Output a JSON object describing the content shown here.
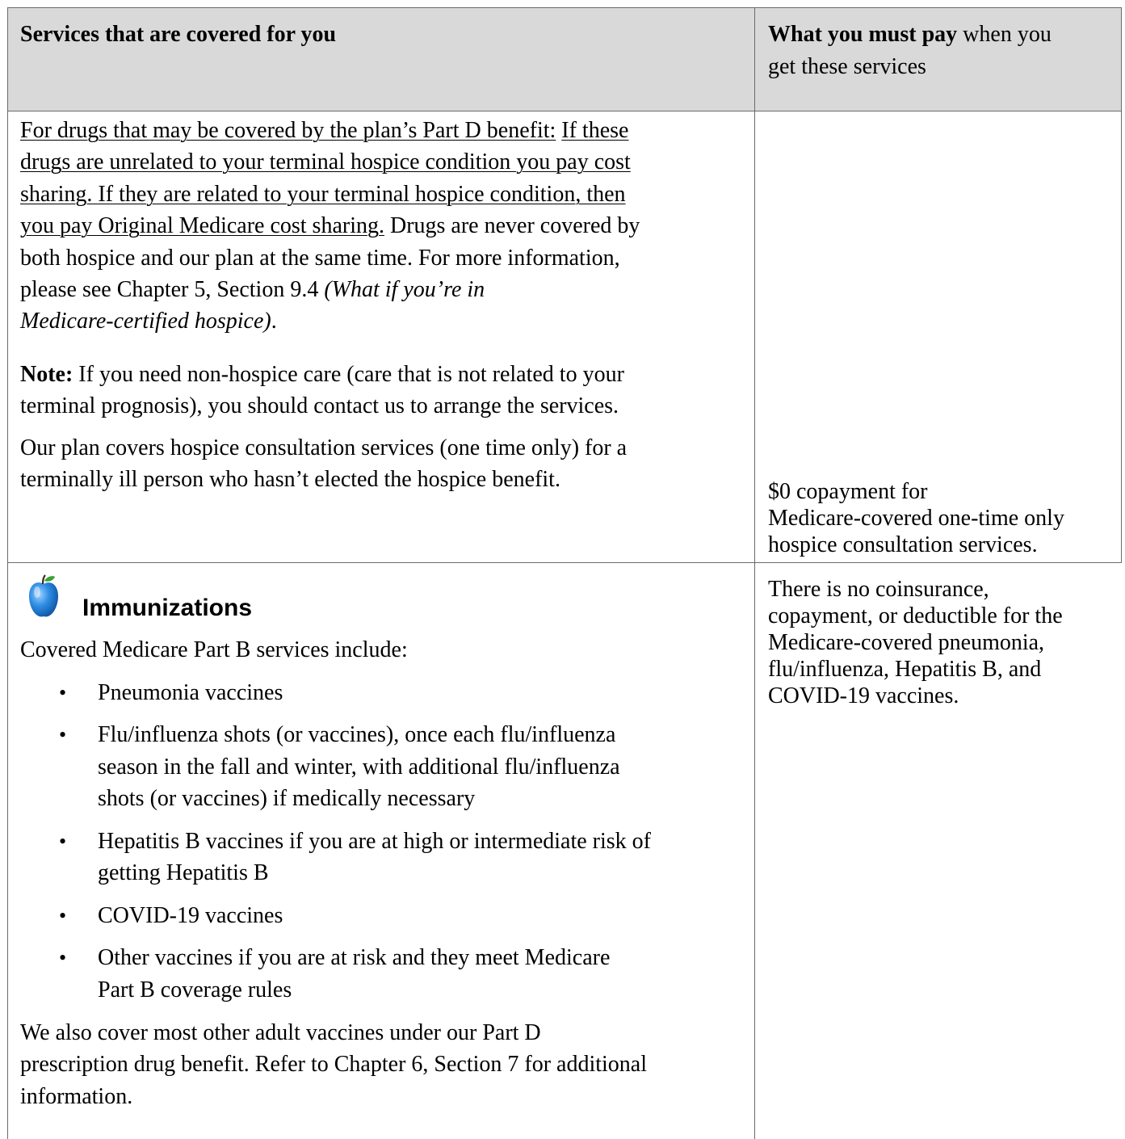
{
  "header": {
    "col1": "Services that are covered for you",
    "col2_bold": "What you must pay",
    "col2_rest": " when you",
    "col2_line2": "get these services"
  },
  "hospice": {
    "p1_line1_a": "For drugs that may be covered by the plan’s Part D benefit:",
    "p1_line1_b": "If these",
    "p1_line2": "drugs are unrelated to your terminal hospice condition you pay cost",
    "p1_line3": "sharing. If they are related to your terminal hospice condition, then",
    "p1_line4_u": "you pay Original Medicare cost sharing.",
    "p1_line4_rest": " Drugs are never covered by",
    "p1_line5": "both hospice and our plan at the same time. For more information,",
    "p1_line6_a": "please see Chapter 5, Section 9.4 ",
    "p1_line6_i": "(What if you’re in",
    "p1_line7_i": "Medicare-certified hospice)",
    "p1_line7_end": ".",
    "note_bold": "Note:",
    "note_line1": " If you need non-hospice care (care that is not related to your",
    "note_line2": "terminal prognosis), you should contact us to arrange the services.",
    "consult_line1": "Our plan covers hospice consultation services (one time only) for a",
    "consult_line2": "terminally ill person who hasn’t elected the hospice benefit.",
    "pay_line1": "$0 copayment for",
    "pay_line2": "Medicare-covered one-time only",
    "pay_line3": "hospice consultation services."
  },
  "immunizations": {
    "icon": "apple-icon",
    "title": "Immunizations",
    "intro": "Covered Medicare Part B services include:",
    "bullet_char": "•",
    "items": [
      {
        "lines": [
          "Pneumonia vaccines"
        ]
      },
      {
        "lines": [
          "Flu/influenza shots (or vaccines), once each flu/influenza",
          "season in the fall and winter, with additional flu/influenza",
          "shots (or vaccines) if medically necessary"
        ]
      },
      {
        "lines": [
          "Hepatitis B vaccines if you are at high or intermediate risk of",
          "getting Hepatitis B"
        ]
      },
      {
        "lines": [
          "COVID-19 vaccines"
        ]
      },
      {
        "lines": [
          "Other vaccines if you are at risk and they meet Medicare",
          "Part B coverage rules"
        ]
      }
    ],
    "footer_line1": "We also cover most other adult vaccines under our Part D",
    "footer_line2": "prescription drug benefit. Refer to Chapter 6, Section 7 for additional",
    "footer_line3": "information.",
    "pay_lines": [
      "There is no coinsurance,",
      "copayment, or deductible for the",
      "Medicare-covered pneumonia,",
      "flu/influenza, Hepatitis B, and",
      "COVID-19 vaccines."
    ]
  }
}
